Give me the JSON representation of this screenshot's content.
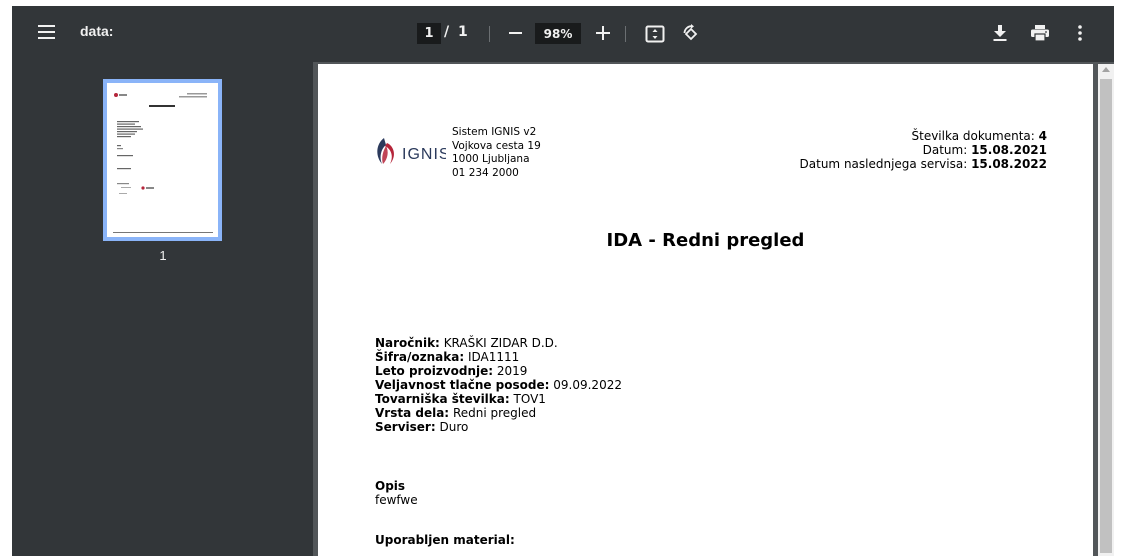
{
  "toolbar": {
    "title": "data:",
    "page_current": "1",
    "page_separator": "/",
    "page_total": "1",
    "zoom": "98%",
    "icons": [
      "menu-icon",
      "minus-icon",
      "plus-icon",
      "fit-page-icon",
      "rotate-icon",
      "download-icon",
      "print-icon",
      "more-vert-icon"
    ]
  },
  "sidebar": {
    "thumbnail_label": "1"
  },
  "document": {
    "company": {
      "line1": "Sistem IGNIS v2",
      "line2": "Vojkova cesta 19",
      "line3": "1000 Ljubljana",
      "line4": "01 234 2000",
      "logo_text": "IGNIS"
    },
    "meta": {
      "doc_number_label": "Številka dokumenta:",
      "doc_number_value": "4",
      "date_label": "Datum:",
      "date_value": "15.08.2021",
      "next_service_label": "Datum naslednjega servisa:",
      "next_service_value": "15.08.2022"
    },
    "heading": "IDA - Redni pregled",
    "fields": [
      {
        "label": "Naročnik:",
        "value": "KRAŠKI ZIDAR D.D."
      },
      {
        "label": "Šifra/oznaka:",
        "value": "IDA1111"
      },
      {
        "label": "Leto proizvodnje:",
        "value": "2019"
      },
      {
        "label": "Veljavnost tlačne posode:",
        "value": "09.09.2022"
      },
      {
        "label": "Tovarniška številka:",
        "value": "TOV1"
      },
      {
        "label": "Vrsta dela:",
        "value": "Redni pregled"
      },
      {
        "label": "Serviser:",
        "value": "Duro"
      }
    ],
    "opis_label": "Opis",
    "opis_value": "fewfwe",
    "material_label": "Uporabljen material:"
  },
  "colors": {
    "toolbar_bg": "#323639",
    "viewer_bg": "#525659",
    "thumb_border": "#8ab4f8",
    "logo_red": "#b5253a",
    "logo_navy": "#2b3a5c"
  }
}
